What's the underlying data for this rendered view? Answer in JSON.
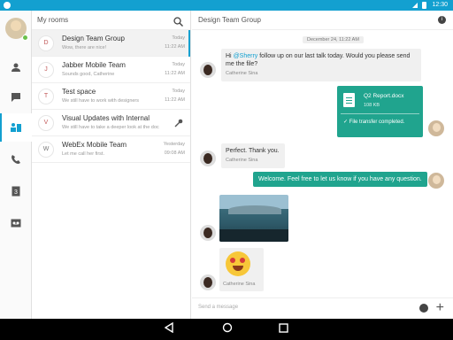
{
  "status_bar": {
    "time": "12:30"
  },
  "rail": {
    "items": [
      {
        "name": "contacts-icon"
      },
      {
        "name": "messages-icon"
      },
      {
        "name": "rooms-icon",
        "active": true
      },
      {
        "name": "call-icon"
      },
      {
        "name": "calendar-icon",
        "badge": "3"
      },
      {
        "name": "voicemail-icon"
      }
    ]
  },
  "rooms_panel": {
    "title": "My rooms",
    "rooms": [
      {
        "initial": "D",
        "name": "Design Team Group",
        "preview": "Wow, there are nice!",
        "date1": "Today",
        "date2": "11:22 AM",
        "active": true
      },
      {
        "initial": "J",
        "name": "Jabber Mobile Team",
        "preview": "Sounds good, Catherine",
        "date1": "Today",
        "date2": "11:22 AM"
      },
      {
        "initial": "T",
        "name": "Test space",
        "preview": "We still have to work with designers",
        "date1": "Today",
        "date2": "11:22 AM"
      },
      {
        "initial": "V",
        "name": "Visual Updates with Internal",
        "preview": "We still have to take a deeper look at the docs",
        "date1": "",
        "date2": "",
        "key": true
      },
      {
        "initial": "W",
        "name": "WebEx Mobile Team",
        "preview": "Let me call her first.",
        "date1": "Yesterday",
        "date2": "09:08 AM"
      }
    ]
  },
  "chat": {
    "title": "Design Team Group",
    "date_chip": "December 24, 11:22 AM",
    "msg1_pre": "Hi ",
    "msg1_mention": "@Sherry",
    "msg1_post": " follow up on our last talk today. Would you please send me the file?",
    "msg1_author": "Catherine Sina",
    "file_name": "Q2 Report.docx",
    "file_size": "108 KB",
    "file_status": "✓ File transfer completed.",
    "msg2_text": "Perfect. Thank you.",
    "msg2_author": "Catherine Sina",
    "msg3_text": "Welcome. Feel free to let us know if you have any question.",
    "emoji_author": "Catherine Sina",
    "composer_placeholder": "Send a message"
  },
  "colors": {
    "accent": "#13a0d0",
    "outgoing": "#20a48e"
  }
}
